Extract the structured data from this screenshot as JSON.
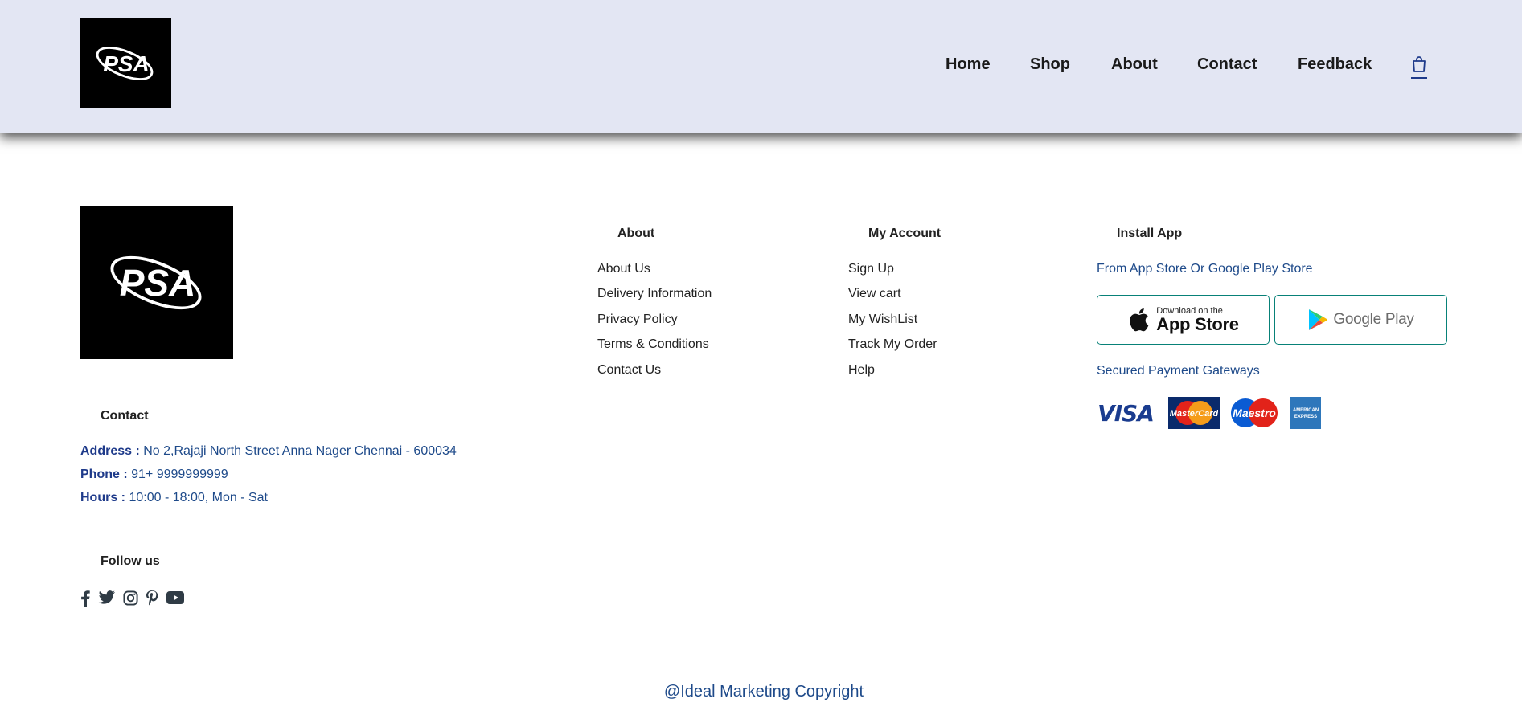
{
  "brand": {
    "logo_text": "PSA"
  },
  "nav": {
    "items": [
      {
        "label": "Home"
      },
      {
        "label": "Shop"
      },
      {
        "label": "About"
      },
      {
        "label": "Contact"
      },
      {
        "label": "Feedback"
      }
    ],
    "cart_icon": "shopping-bag-icon"
  },
  "footer": {
    "contact": {
      "title": "Contact",
      "address_label": "Address :",
      "address_value": "No 2,Rajaji North Street Anna Nager Chennai - 600034",
      "phone_label": "Phone :",
      "phone_value": "91+ 9999999999",
      "hours_label": "Hours :",
      "hours_value": "10:00 - 18:00, Mon - Sat"
    },
    "follow": {
      "title": "Follow us",
      "icons": [
        "facebook-icon",
        "twitter-icon",
        "instagram-icon",
        "pinterest-icon",
        "youtube-icon"
      ]
    },
    "about": {
      "title": "About",
      "links": [
        "About Us",
        "Delivery Information",
        "Privacy Policy",
        "Terms & Conditions",
        "Contact Us"
      ]
    },
    "account": {
      "title": "My Account",
      "links": [
        "Sign Up",
        "View cart",
        "My WishList",
        "Track My Order",
        "Help"
      ]
    },
    "install": {
      "title": "Install App",
      "subtitle": "From App Store Or Google Play Store",
      "app_store_small": "Download on the",
      "app_store_big": "App Store",
      "google_play": "Google Play",
      "payments_title": "Secured Payment Gateways",
      "cards": [
        "VISA",
        "MasterCard",
        "Maestro",
        "AMERICAN EXPRESS"
      ]
    },
    "copyright": "@Ideal Marketing Copyright"
  },
  "colors": {
    "header_bg": "#e3e6f3",
    "accent": "#088178",
    "link_blue": "#1e4a8a"
  }
}
